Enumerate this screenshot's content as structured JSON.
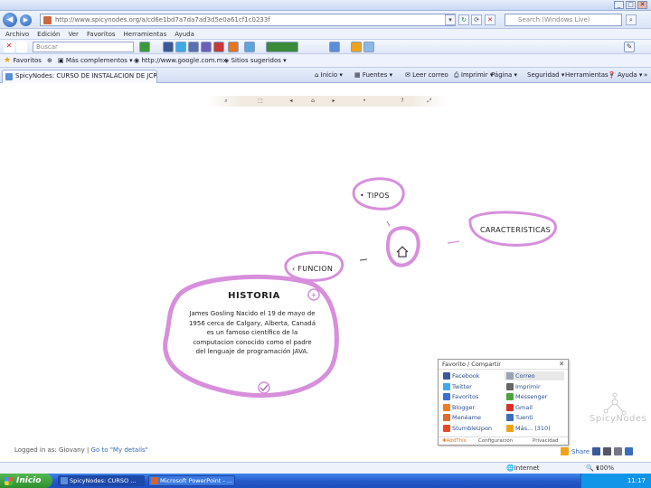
{
  "browser": {
    "url": "http://www.spicynodes.org/a/cd6e1bd7a7da7ad3d5e0a61cf1c0233f",
    "search_placeholder": "Search (Windows Live)",
    "menu": [
      "Archivo",
      "Edición",
      "Ver",
      "Favoritos",
      "Herramientas",
      "Ayuda"
    ],
    "toolbar_search_placeholder": "Buscar",
    "favorites_label": "Favoritos",
    "favorites_items": [
      "Más complementos",
      "http://www.google.com.mx",
      "Sitios sugeridos"
    ],
    "tab_title": "SpicyNodes: CURSO DE INSTALACION DE JCREATOR",
    "commands": [
      "Inicio",
      "Fuentes",
      "Leer correo",
      "Imprimir",
      "Página",
      "Seguridad",
      "Herramientas",
      "Ayuda"
    ]
  },
  "mindmap": {
    "toolbar_icons": [
      "zoom-icon",
      "fit-icon",
      "back-icon",
      "home-icon",
      "forward-icon",
      "info-icon",
      "help-icon",
      "fullscreen-icon"
    ],
    "nodes": {
      "tipos": "• TIPOS",
      "caracteristicas": "CARACTERISTICAS",
      "funcion": "‹ FUNCION"
    },
    "historia": {
      "title": "HISTORIA",
      "text": "James Gosling Nacido el 19 de mayo de 1956 cerca de Calgary, Alberta, Canadá es un famoso científico de la computacion conocido como el padre del lenguaje de programación JAVA."
    },
    "login_text": "Logged in as: Giovany",
    "login_sep": " | ",
    "login_link": "Go to \"My details\"",
    "brand": "SpicyNodes"
  },
  "share_popup": {
    "title": "Favorito / Compartir",
    "items": [
      {
        "label": "Facebook",
        "color": "#3b5998"
      },
      {
        "label": "Correo",
        "color": "#9aa3b3"
      },
      {
        "label": "Twitter",
        "color": "#3ea9e8"
      },
      {
        "label": "Imprimir",
        "color": "#666666"
      },
      {
        "label": "Favoritos",
        "color": "#3a6fd8"
      },
      {
        "label": "Messenger",
        "color": "#4aa33b"
      },
      {
        "label": "Blogger",
        "color": "#f47b20"
      },
      {
        "label": "Gmail",
        "color": "#d93025"
      },
      {
        "label": "Menéame",
        "color": "#e06b2a"
      },
      {
        "label": "Tuenti",
        "color": "#3b6fb6"
      },
      {
        "label": "StumbleUpon",
        "color": "#eb4924"
      },
      {
        "label": "Más... (310)",
        "color": "#f0a31a"
      }
    ],
    "footer_left": "AddThis",
    "footer_mid": "Configuración",
    "footer_right": "Privacidad"
  },
  "share_link": "Share",
  "statusbar": {
    "zone": "Internet",
    "zoom": "100%"
  },
  "taskbar": {
    "start": "Inicio",
    "tasks": [
      "SpicyNodes: CURSO ...",
      "Microsoft PowerPoint - ..."
    ],
    "time": "11:17"
  },
  "colors": {
    "node_accent": "#d78fdc",
    "link_blue": "#3568b8",
    "taskbar_blue": "#2458c9"
  }
}
